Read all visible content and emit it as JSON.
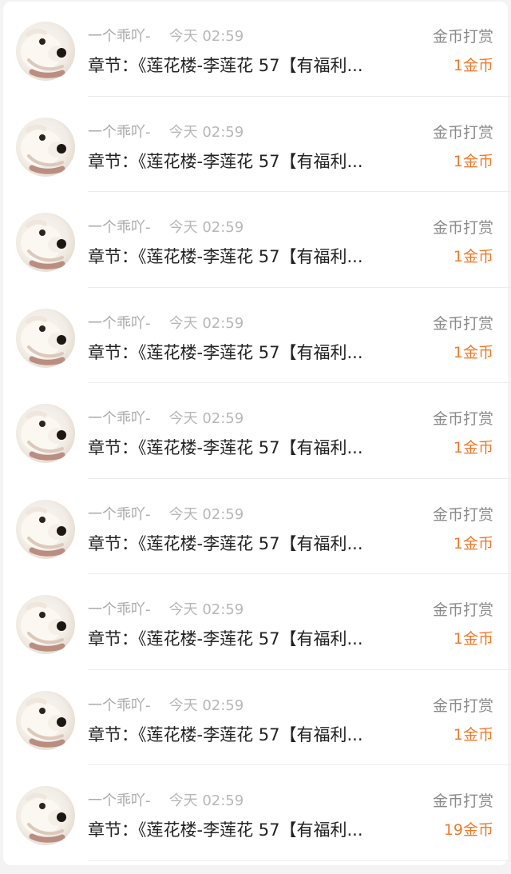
{
  "items": [
    {
      "user": "一个乖吖-",
      "time": "今天 02:59",
      "chapter": "章节：《莲花楼-李莲花 57【有福利...",
      "reward_type": "金币打赏",
      "amount": "1金币"
    },
    {
      "user": "一个乖吖-",
      "time": "今天 02:59",
      "chapter": "章节：《莲花楼-李莲花 57【有福利...",
      "reward_type": "金币打赏",
      "amount": "1金币"
    },
    {
      "user": "一个乖吖-",
      "time": "今天 02:59",
      "chapter": "章节：《莲花楼-李莲花 57【有福利...",
      "reward_type": "金币打赏",
      "amount": "1金币"
    },
    {
      "user": "一个乖吖-",
      "time": "今天 02:59",
      "chapter": "章节：《莲花楼-李莲花 57【有福利...",
      "reward_type": "金币打赏",
      "amount": "1金币"
    },
    {
      "user": "一个乖吖-",
      "time": "今天 02:59",
      "chapter": "章节：《莲花楼-李莲花 57【有福利...",
      "reward_type": "金币打赏",
      "amount": "1金币"
    },
    {
      "user": "一个乖吖-",
      "time": "今天 02:59",
      "chapter": "章节：《莲花楼-李莲花 57【有福利...",
      "reward_type": "金币打赏",
      "amount": "1金币"
    },
    {
      "user": "一个乖吖-",
      "time": "今天 02:59",
      "chapter": "章节：《莲花楼-李莲花 57【有福利...",
      "reward_type": "金币打赏",
      "amount": "1金币"
    },
    {
      "user": "一个乖吖-",
      "time": "今天 02:59",
      "chapter": "章节：《莲花楼-李莲花 57【有福利...",
      "reward_type": "金币打赏",
      "amount": "1金币"
    },
    {
      "user": "一个乖吖-",
      "time": "今天 02:59",
      "chapter": "章节：《莲花楼-李莲花 57【有福利...",
      "reward_type": "金币打赏",
      "amount": "19金币"
    }
  ],
  "icons": {
    "avatar": "dog-avatar-icon"
  },
  "colors": {
    "amount": "#f07b2c",
    "meta": "#aaaaaa",
    "chapter": "#222222"
  }
}
